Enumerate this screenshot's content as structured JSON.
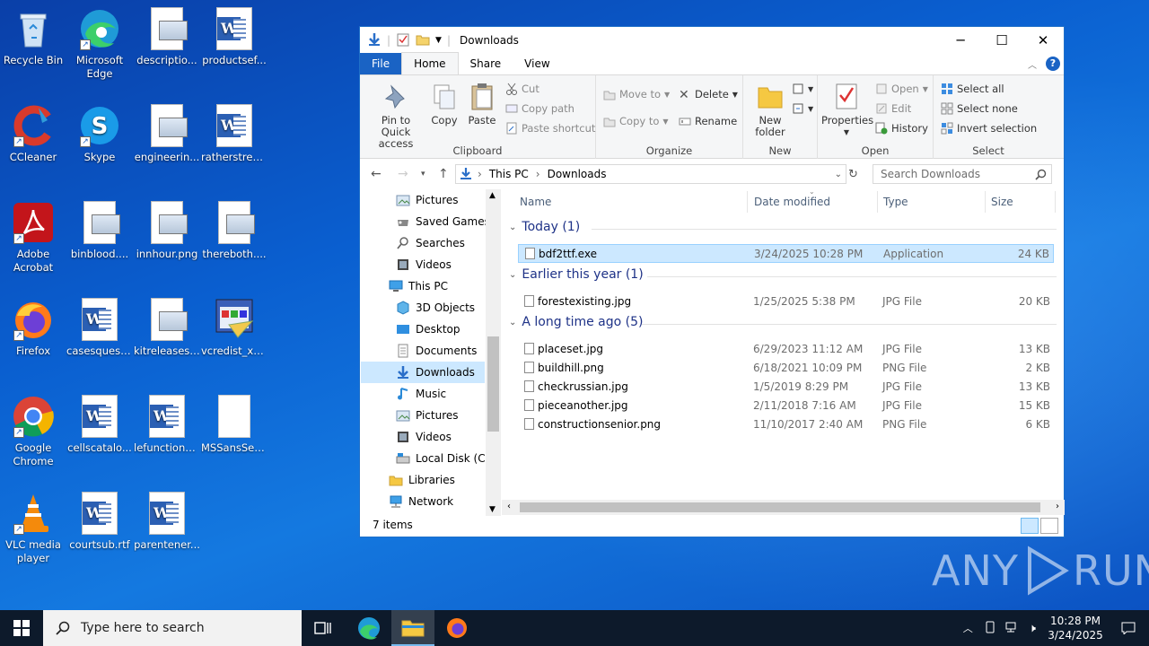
{
  "desktop": {
    "icons": [
      {
        "label": "Recycle Bin"
      },
      {
        "label": "Microsoft Edge"
      },
      {
        "label": "descriptio..."
      },
      {
        "label": "productsef..."
      },
      {
        "label": "CCleaner"
      },
      {
        "label": "Skype"
      },
      {
        "label": "engineerin..."
      },
      {
        "label": "ratherstreet..."
      },
      {
        "label": "Adobe Acrobat"
      },
      {
        "label": "binblood...."
      },
      {
        "label": "innhour.png"
      },
      {
        "label": "thereboth...."
      },
      {
        "label": "Firefox"
      },
      {
        "label": "casesquest..."
      },
      {
        "label": "kitreleases...."
      },
      {
        "label": "vcredist_x6..."
      },
      {
        "label": "Google Chrome"
      },
      {
        "label": "cellscatalo..."
      },
      {
        "label": "lefunctiona..."
      },
      {
        "label": "MSSansSeri..."
      },
      {
        "label": "VLC media player"
      },
      {
        "label": "courtsub.rtf"
      },
      {
        "label": "parentener..."
      }
    ]
  },
  "window": {
    "title": "Downloads",
    "tabs": {
      "file": "File",
      "home": "Home",
      "share": "Share",
      "view": "View"
    },
    "ribbon": {
      "clipboard": {
        "pin": "Pin to Quick access",
        "copy": "Copy",
        "paste": "Paste",
        "cut": "Cut",
        "copy_path": "Copy path",
        "paste_shortcut": "Paste shortcut",
        "label": "Clipboard"
      },
      "organize": {
        "move_to": "Move to",
        "copy_to": "Copy to",
        "delete": "Delete",
        "rename": "Rename",
        "label": "Organize"
      },
      "new": {
        "new_folder": "New folder",
        "label": "New"
      },
      "open": {
        "properties": "Properties",
        "open": "Open",
        "edit": "Edit",
        "history": "History",
        "label": "Open"
      },
      "select": {
        "select_all": "Select all",
        "select_none": "Select none",
        "invert": "Invert selection",
        "label": "Select"
      }
    },
    "address": {
      "this_pc": "This PC",
      "downloads": "Downloads",
      "search_placeholder": "Search Downloads"
    },
    "nav": [
      {
        "label": "Pictures"
      },
      {
        "label": "Saved Games"
      },
      {
        "label": "Searches"
      },
      {
        "label": "Videos"
      },
      {
        "label": "This PC"
      },
      {
        "label": "3D Objects"
      },
      {
        "label": "Desktop"
      },
      {
        "label": "Documents"
      },
      {
        "label": "Downloads"
      },
      {
        "label": "Music"
      },
      {
        "label": "Pictures"
      },
      {
        "label": "Videos"
      },
      {
        "label": "Local Disk (C:)"
      },
      {
        "label": "Libraries"
      },
      {
        "label": "Network"
      }
    ],
    "columns": {
      "name": "Name",
      "date": "Date modified",
      "type": "Type",
      "size": "Size"
    },
    "groups": [
      {
        "label": "Today (1)",
        "files": [
          {
            "name": "bdf2ttf.exe",
            "date": "3/24/2025 10:28 PM",
            "type": "Application",
            "size": "24 KB"
          }
        ]
      },
      {
        "label": "Earlier this year (1)",
        "files": [
          {
            "name": "forestexisting.jpg",
            "date": "1/25/2025 5:38 PM",
            "type": "JPG File",
            "size": "20 KB"
          }
        ]
      },
      {
        "label": "A long time ago (5)",
        "files": [
          {
            "name": "placeset.jpg",
            "date": "6/29/2023 11:12 AM",
            "type": "JPG File",
            "size": "13 KB"
          },
          {
            "name": "buildhill.png",
            "date": "6/18/2021 10:09 PM",
            "type": "PNG File",
            "size": "2 KB"
          },
          {
            "name": "checkrussian.jpg",
            "date": "1/5/2019 8:29 PM",
            "type": "JPG File",
            "size": "13 KB"
          },
          {
            "name": "pieceanother.jpg",
            "date": "2/11/2018 7:16 AM",
            "type": "JPG File",
            "size": "15 KB"
          },
          {
            "name": "constructionsenior.png",
            "date": "11/10/2017 2:40 AM",
            "type": "PNG File",
            "size": "6 KB"
          }
        ]
      }
    ],
    "status": "7 items"
  },
  "taskbar": {
    "search_placeholder": "Type here to search",
    "time": "10:28 PM",
    "date": "3/24/2025"
  },
  "watermark": {
    "left": "ANY",
    "right": "RUN"
  }
}
